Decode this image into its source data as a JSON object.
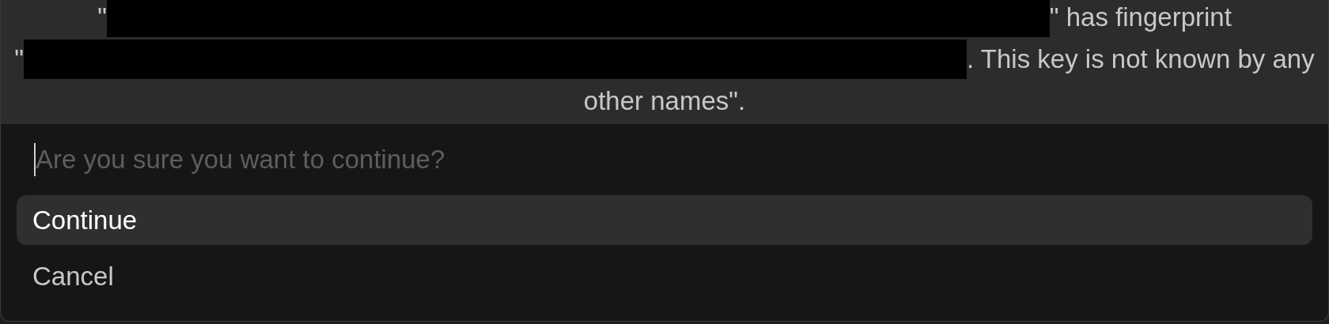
{
  "message": {
    "lines": [
      {
        "parts": [
          {
            "kind": "text",
            "text": "\""
          },
          {
            "kind": "redacted"
          },
          {
            "kind": "text",
            "text": "\" has fingerprint"
          }
        ]
      },
      {
        "parts": [
          {
            "kind": "text",
            "text": "\""
          },
          {
            "kind": "redacted"
          },
          {
            "kind": "text",
            "text": ". This key is not known by any"
          }
        ]
      },
      {
        "parts": [
          {
            "kind": "text",
            "text": "other names\"."
          }
        ]
      }
    ]
  },
  "prompt": {
    "placeholder": "Are you sure you want to continue?"
  },
  "options": [
    {
      "label": "Continue",
      "selected": true
    },
    {
      "label": "Cancel",
      "selected": false
    }
  ]
}
